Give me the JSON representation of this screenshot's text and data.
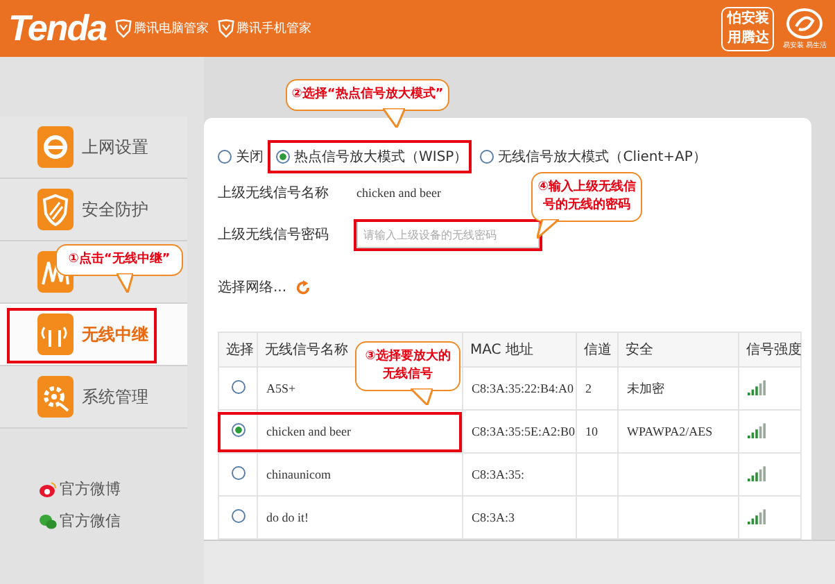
{
  "header": {
    "brand": "Tenda",
    "links": [
      "腾讯电脑管家",
      "腾讯手机管家"
    ],
    "badge": [
      "怕安装",
      "用腾达"
    ],
    "slogan": "易安装 易生活"
  },
  "sidebar": {
    "items": [
      {
        "kind": "internet",
        "label": "上网设置",
        "selected": false
      },
      {
        "kind": "security",
        "label": "安全防护",
        "selected": false
      },
      {
        "kind": "wireless",
        "selected": false
      },
      {
        "kind": "repeater",
        "label": "无线中继",
        "selected": true
      },
      {
        "kind": "system",
        "label": "系统管理",
        "selected": false
      }
    ],
    "social": [
      {
        "kind": "weibo",
        "label": "官方微博"
      },
      {
        "kind": "wechat",
        "label": "官方微信"
      }
    ]
  },
  "modes": [
    {
      "label": "关闭",
      "selected": false
    },
    {
      "label": "热点信号放大模式（WISP）",
      "selected": true
    },
    {
      "label": "无线信号放大模式（Client+AP）",
      "selected": false
    }
  ],
  "upstream_name": {
    "label": "上级无线信号名称",
    "value": "chicken and beer"
  },
  "upstream_password": {
    "label": "上级无线信号密码",
    "placeholder": "请输入上级设备的无线密码"
  },
  "select_network": "选择网络...",
  "table": {
    "columns": [
      "选择",
      "无线信号名称",
      "MAC 地址",
      "信道",
      "安全",
      "信号强度"
    ],
    "rows": [
      {
        "selected": false,
        "name": "A5S+",
        "mac": "C8:3A:35:22:B4:A0",
        "channel": "2",
        "security": "未加密"
      },
      {
        "selected": true,
        "name": "chicken and beer",
        "mac": "C8:3A:35:5E:A2:B0",
        "channel": "10",
        "security": "WPAWPA2/AES"
      },
      {
        "selected": false,
        "name": "chinaunicom",
        "mac": "C8:3A:35:"
      },
      {
        "selected": false,
        "name": "do do it!",
        "mac": "C8:3A:3"
      }
    ]
  },
  "annotations": [
    {
      "kind": "sidebar",
      "text": "①点击“无线中继”"
    },
    {
      "kind": "mode",
      "text": "②选择“热点信号放大模式”"
    },
    {
      "kind": "row",
      "text": "③选择要放大的无线信号"
    },
    {
      "kind": "password",
      "text": "④输入上级无线信号的无线的密码"
    }
  ]
}
